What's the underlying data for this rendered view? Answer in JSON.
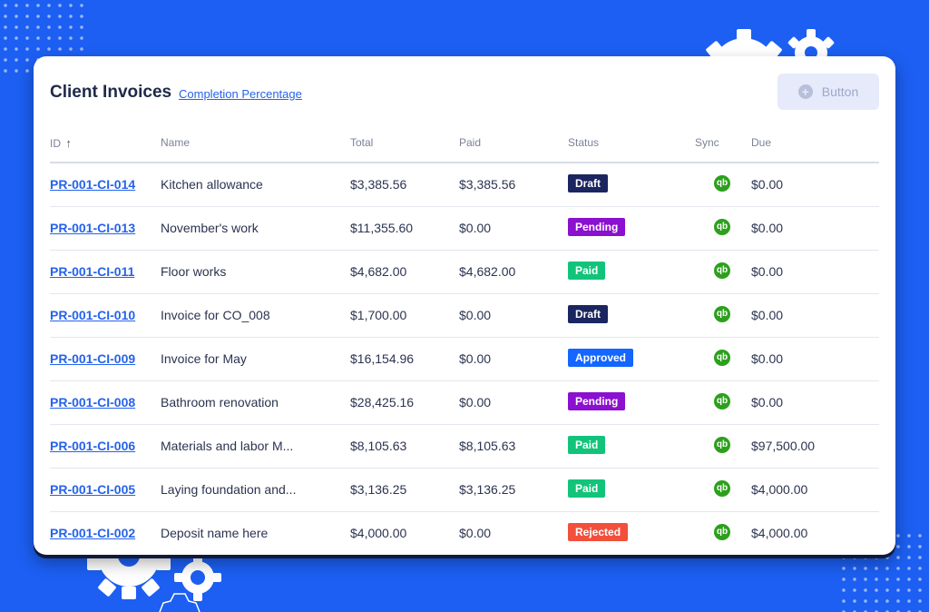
{
  "header": {
    "title": "Client Invoices",
    "link_label": "Completion Percentage",
    "button_label": "Button"
  },
  "columns": [
    "ID",
    "Name",
    "Total",
    "Paid",
    "Status",
    "Sync",
    "Due"
  ],
  "sort_indicator": "↑",
  "sync_icon_text": "qb",
  "status_colors": {
    "Draft": "#1b2660",
    "Pending": "#8b10cf",
    "Paid": "#12c47a",
    "Approved": "#1366ff",
    "Rejected": "#f2503c"
  },
  "rows": [
    {
      "id": "PR-001-CI-014",
      "name": "Kitchen allowance",
      "total": "$3,385.56",
      "paid": "$3,385.56",
      "status": "Draft",
      "due": "$0.00"
    },
    {
      "id": "PR-001-CI-013",
      "name": "November's work",
      "total": "$11,355.60",
      "paid": "$0.00",
      "status": "Pending",
      "due": "$0.00"
    },
    {
      "id": "PR-001-CI-011",
      "name": "Floor works",
      "total": "$4,682.00",
      "paid": "$4,682.00",
      "status": "Paid",
      "due": "$0.00"
    },
    {
      "id": "PR-001-CI-010",
      "name": "Invoice for CO_008",
      "total": "$1,700.00",
      "paid": "$0.00",
      "status": "Draft",
      "due": "$0.00"
    },
    {
      "id": "PR-001-CI-009",
      "name": "Invoice for May",
      "total": "$16,154.96",
      "paid": "$0.00",
      "status": "Approved",
      "due": "$0.00"
    },
    {
      "id": "PR-001-CI-008",
      "name": "Bathroom renovation",
      "total": "$28,425.16",
      "paid": "$0.00",
      "status": "Pending",
      "due": "$0.00"
    },
    {
      "id": "PR-001-CI-006",
      "name": "Materials and labor M...",
      "total": "$8,105.63",
      "paid": "$8,105.63",
      "status": "Paid",
      "due": "$97,500.00"
    },
    {
      "id": "PR-001-CI-005",
      "name": "Laying foundation and...",
      "total": "$3,136.25",
      "paid": "$3,136.25",
      "status": "Paid",
      "due": "$4,000.00"
    },
    {
      "id": "PR-001-CI-002",
      "name": "Deposit name here",
      "total": "$4,000.00",
      "paid": "$0.00",
      "status": "Rejected",
      "due": "$4,000.00"
    }
  ]
}
